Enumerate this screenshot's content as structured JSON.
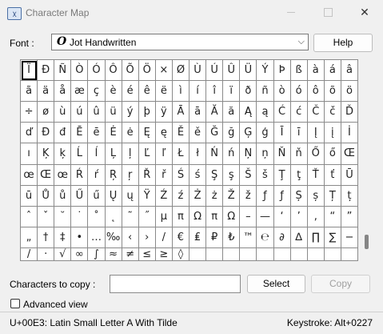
{
  "window": {
    "title": "Character Map",
    "icon": "character-map-app-icon",
    "icon_glyph": "ꭓ"
  },
  "controls": {
    "minimize": "minimize-icon",
    "maximize": "maximize-icon",
    "close": "✕"
  },
  "font": {
    "label": "Font :",
    "selected": "Jot Handwritten",
    "icon_glyph": "O"
  },
  "help_label": "Help",
  "grid": {
    "cells": [
      "Ï",
      "Ð",
      "Ñ",
      "Ò",
      "Ó",
      "Ô",
      "Õ",
      "Ö",
      "×",
      "Ø",
      "Ù",
      "Ú",
      "Û",
      "Ü",
      "Ý",
      "Þ",
      "ß",
      "à",
      "á",
      "â",
      "ã",
      "ä",
      "å",
      "æ",
      "ç",
      "è",
      "é",
      "ê",
      "ë",
      "ì",
      "í",
      "î",
      "ï",
      "ð",
      "ñ",
      "ò",
      "ó",
      "ô",
      "õ",
      "ö",
      "÷",
      "ø",
      "ù",
      "ú",
      "û",
      "ü",
      "ý",
      "þ",
      "ÿ",
      "Ā",
      "ā",
      "Ă",
      "ă",
      "Ą",
      "ą",
      "Ć",
      "ć",
      "Č",
      "č",
      "Ď",
      "ď",
      "Đ",
      "đ",
      "Ē",
      "ē",
      "Ė",
      "ė",
      "Ę",
      "ę",
      "Ě",
      "ě",
      "Ğ",
      "ğ",
      "Ģ",
      "ģ",
      "Ī",
      "ī",
      "Į",
      "į",
      "İ",
      "ı",
      "Ķ",
      "ķ",
      "Ĺ",
      "ĺ",
      "Ļ",
      "ļ",
      "Ľ",
      "ľ",
      "Ł",
      "ł",
      "Ń",
      "ń",
      "Ņ",
      "ņ",
      "Ň",
      "ň",
      "Ő",
      "ő",
      "Œ",
      "œ",
      "Œ",
      "œ",
      "Ŕ",
      "ŕ",
      "Ŗ",
      "ŗ",
      "Ř",
      "ř",
      "Ś",
      "ś",
      "Ş",
      "ş",
      "Š",
      "š",
      "Ţ",
      "ţ",
      "Ť",
      "ť",
      "Ū",
      "ū",
      "Ů",
      "ů",
      "Ű",
      "ű",
      "Ų",
      "ų",
      "Ÿ",
      "Ź",
      "ź",
      "Ż",
      "ż",
      "Ž",
      "ž",
      "ƒ",
      "ƒ",
      "Ș",
      "ș",
      "Ț",
      "ț",
      "ˆ",
      "ˇ",
      "˘",
      "˙",
      "˚",
      "˛",
      "˜",
      "˝",
      "μ",
      "π",
      "Ω",
      "π",
      "Ω",
      "–",
      "—",
      "‘",
      "’",
      "‚",
      "“",
      "”",
      "„",
      "†",
      "‡",
      "•",
      "…",
      "‰",
      "‹",
      "›",
      "/",
      "€",
      "₤",
      "₽",
      "₺",
      "™",
      "℮",
      "∂",
      "∆",
      "∏",
      "∑",
      "−",
      "/",
      "·",
      "√",
      "∞",
      "∫",
      "≈",
      "≠",
      "≤",
      "≥",
      "◊",
      "",
      "",
      "",
      "",
      "",
      "",
      "",
      "",
      "",
      ""
    ]
  },
  "copy": {
    "label": "Characters to copy :",
    "value": "",
    "select_label": "Select",
    "copy_label": "Copy"
  },
  "advanced_view": {
    "label": "Advanced view",
    "checked": false
  },
  "status": {
    "info": "U+00E3: Latin Small Letter A With Tilde",
    "keystroke": "Keystroke: Alt+0227"
  }
}
